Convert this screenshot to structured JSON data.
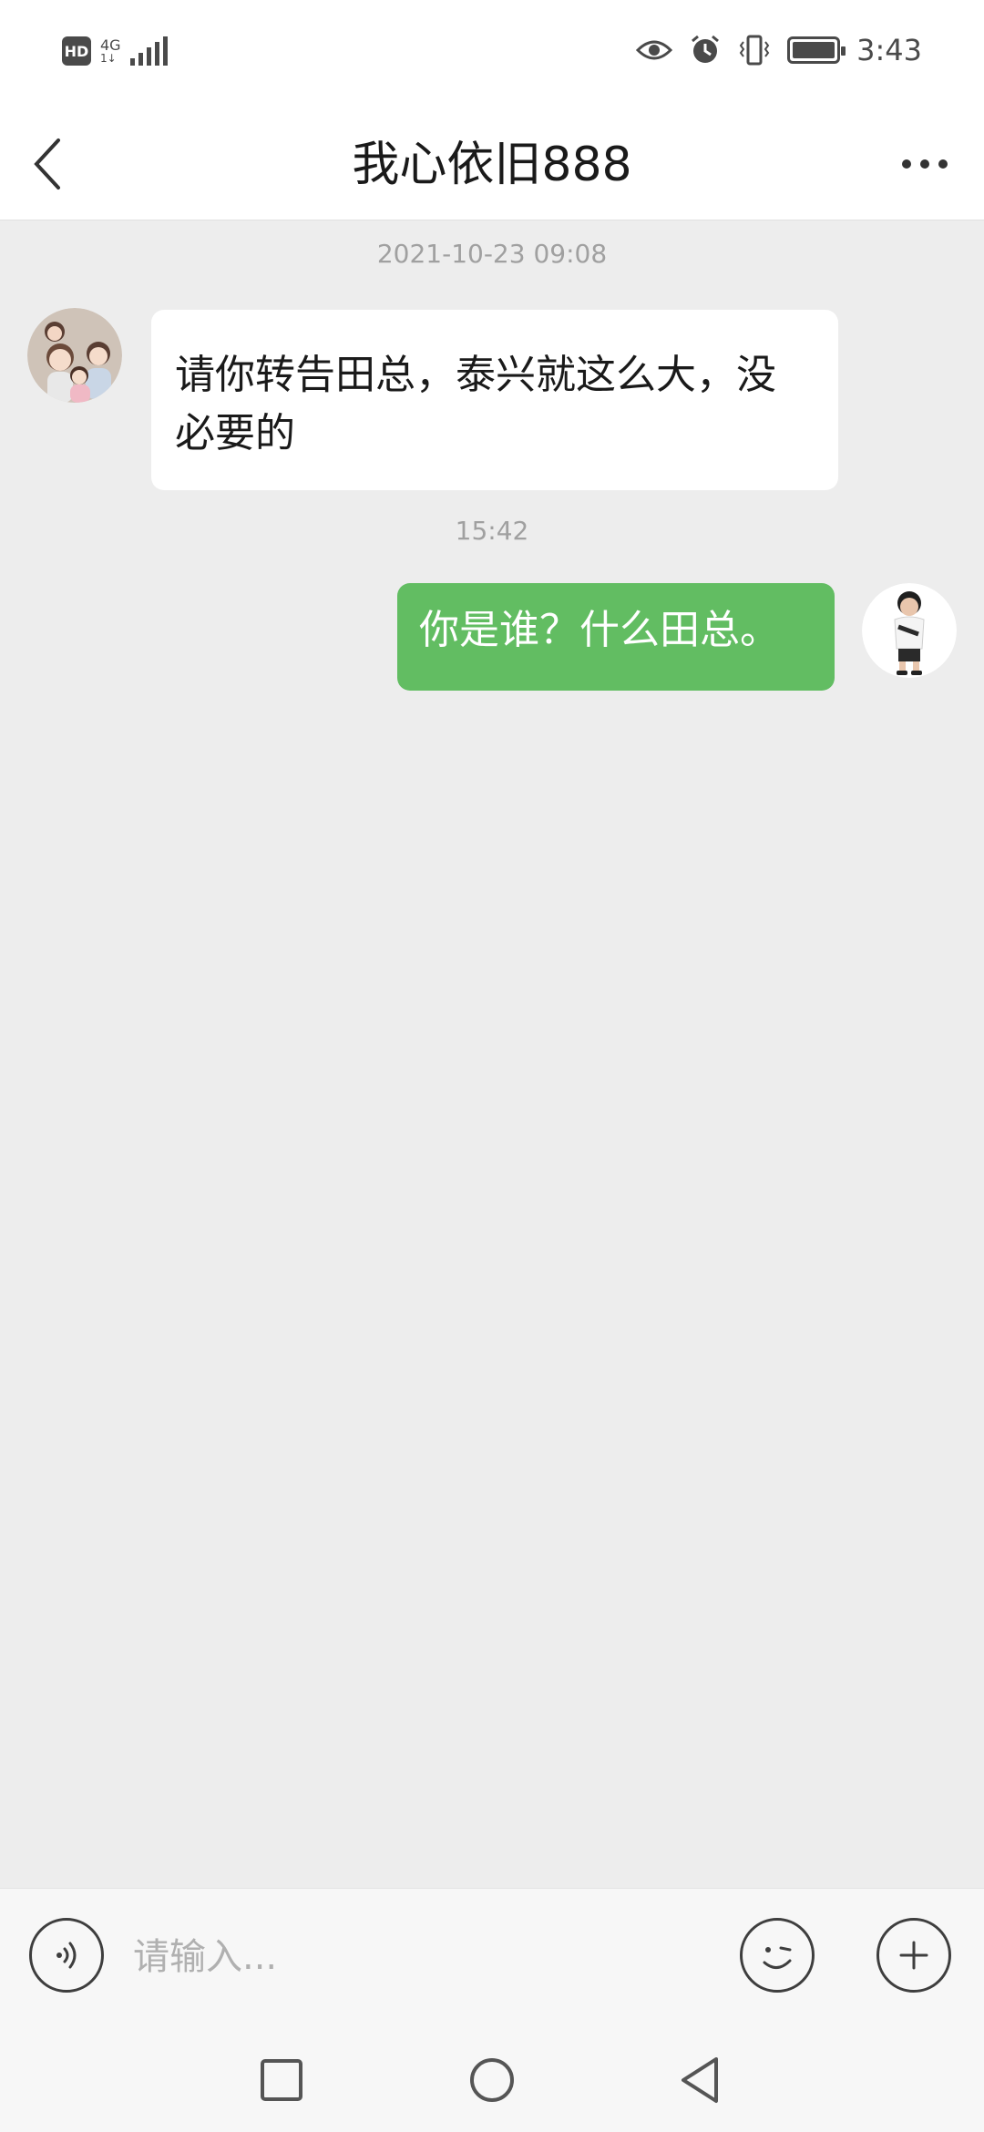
{
  "status_bar": {
    "hd": "HD",
    "network": "4G",
    "network_sub": "1↓",
    "time": "3:43"
  },
  "header": {
    "title": "我心依旧888"
  },
  "messages": [
    {
      "type": "timestamp",
      "text": "2021-10-23 09:08"
    },
    {
      "type": "incoming",
      "text": "请你转告田总，泰兴就这么大，没必要的"
    },
    {
      "type": "timestamp",
      "text": "15:42"
    },
    {
      "type": "outgoing",
      "text": "你是谁？什么田总。"
    }
  ],
  "input": {
    "placeholder": "请输入..."
  },
  "icons": {
    "back": "chevron-left-icon",
    "more": "more-dots-icon",
    "voice": "voice-icon",
    "emoji": "emoji-icon",
    "plus": "plus-icon",
    "nav_recent": "square-icon",
    "nav_home": "circle-icon",
    "nav_back": "triangle-back-icon"
  },
  "colors": {
    "outgoing_bubble": "#62bd62",
    "incoming_bubble": "#ffffff",
    "chat_background": "#ededed"
  }
}
